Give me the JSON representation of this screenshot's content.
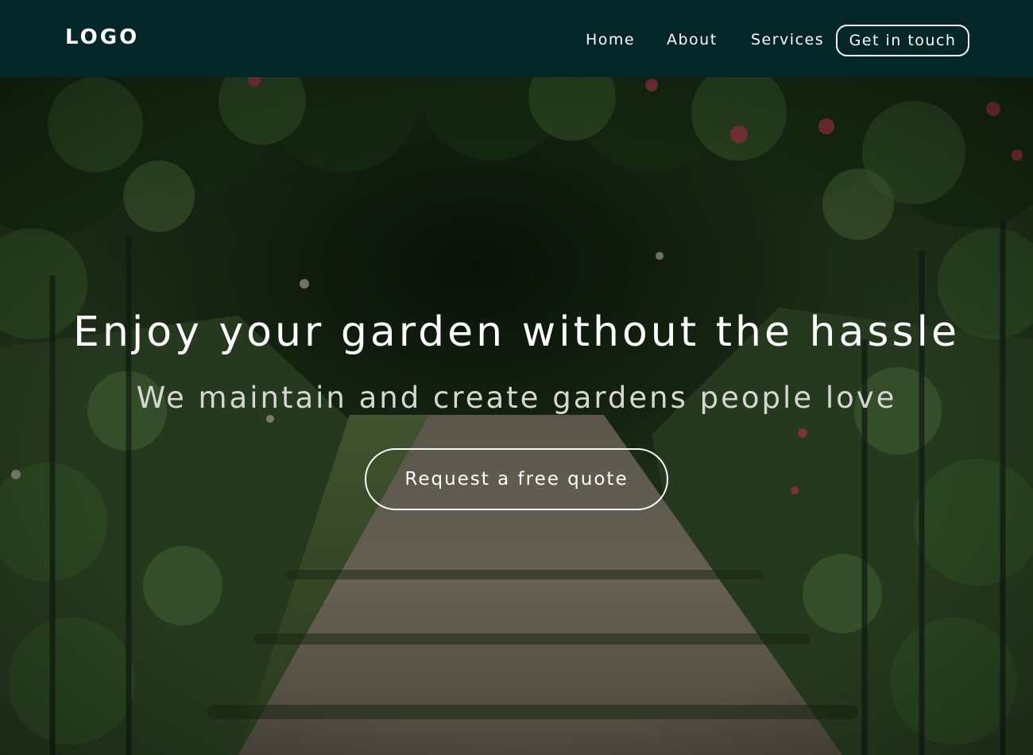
{
  "header": {
    "logo": "LOGO",
    "nav": {
      "home": "Home",
      "about": "About",
      "services": "Services"
    },
    "cta_label": "Get in touch"
  },
  "hero": {
    "title": "Enjoy your garden without the hassle",
    "subtitle": "We maintain and create gardens people love",
    "cta_label": "Request a free quote"
  },
  "colors": {
    "header_background": "#032628",
    "text": "#ffffff",
    "subtitle_text": "#d6d6d2"
  }
}
